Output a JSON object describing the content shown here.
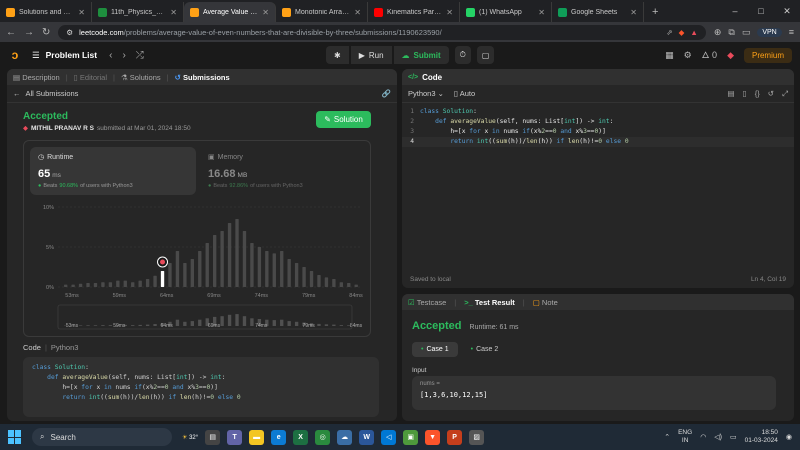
{
  "browser": {
    "tabs": [
      {
        "title": "Solutions and Explanation",
        "color": "#ffa116",
        "active": false
      },
      {
        "title": "11th_Physics_Vol_1_EM -",
        "color": "#1e8e3e",
        "active": false
      },
      {
        "title": "Average Value of Even",
        "color": "#ffa116",
        "active": true
      },
      {
        "title": "Monotonic Array - LeetC",
        "color": "#ffa116",
        "active": false
      },
      {
        "title": "Kinematics Part 3: Project",
        "color": "#ff0000",
        "active": false
      },
      {
        "title": "(1) WhatsApp",
        "color": "#25d366",
        "active": false
      },
      {
        "title": "Google Sheets",
        "color": "#0f9d58",
        "active": false
      }
    ],
    "url_host": "leetcode.com",
    "url_path": "/problems/average-value-of-even-numbers-that-are-divisible-by-three/submissions/1190623590/",
    "vpn_label": "VPN"
  },
  "lc_nav": {
    "problem_list": "Problem List",
    "run": "Run",
    "submit": "Submit",
    "streak": "0",
    "premium": "Premium"
  },
  "left": {
    "tabs": {
      "description": "Description",
      "editorial": "Editorial",
      "solutions": "Solutions",
      "submissions": "Submissions"
    },
    "all_submissions": "All Submissions",
    "status": "Accepted",
    "user": "MITHIL PRANAV R S",
    "submitted_at": "submitted at Mar 01, 2024 18:50",
    "solution_button": "Solution",
    "runtime": {
      "label": "Runtime",
      "value": "65",
      "unit": "ms",
      "beats_prefix": "Beats",
      "beats_pct": "90.68%",
      "beats_suffix": "of users with Python3"
    },
    "memory": {
      "label": "Memory",
      "value": "16.68",
      "unit": "MB",
      "beats_prefix": "Beats",
      "beats_pct": "92.86%",
      "beats_suffix": "of users with Python3"
    },
    "code_label": "Code",
    "code_lang": "Python3"
  },
  "chart_data": {
    "type": "bar",
    "y_ticks": [
      "10%",
      "5%",
      "0%"
    ],
    "ylim": [
      0,
      10
    ],
    "x_tick_labels": [
      "53ms",
      "59ms",
      "64ms",
      "69ms",
      "74ms",
      "79ms",
      "84ms"
    ],
    "values": [
      0.3,
      0.3,
      0.4,
      0.5,
      0.5,
      0.6,
      0.6,
      0.8,
      0.8,
      0.6,
      0.8,
      1.0,
      1.4,
      2.0,
      3.0,
      4.5,
      3.0,
      3.5,
      4.5,
      5.5,
      6.5,
      7.0,
      8.0,
      8.5,
      7.0,
      5.5,
      5.0,
      4.5,
      4.2,
      4.5,
      3.5,
      3.0,
      2.5,
      2.0,
      1.5,
      1.2,
      1.0,
      0.6,
      0.5,
      0.3
    ],
    "highlight_index": 13,
    "highlight_color": "#ffffff",
    "bar_color": "#4a4a4a",
    "grid": true
  },
  "code_lines": [
    [
      {
        "t": "class ",
        "c": "kw"
      },
      {
        "t": "Solution",
        "c": "cls"
      },
      {
        "t": ":",
        "c": ""
      }
    ],
    [
      {
        "t": "    ",
        "c": ""
      },
      {
        "t": "def ",
        "c": "kw"
      },
      {
        "t": "averageValue",
        "c": "fn"
      },
      {
        "t": "(self, nums: List[",
        "c": ""
      },
      {
        "t": "int",
        "c": "cls"
      },
      {
        "t": "]) -> ",
        "c": ""
      },
      {
        "t": "int",
        "c": "cls"
      },
      {
        "t": ":",
        "c": ""
      }
    ],
    [
      {
        "t": "        h=[x ",
        "c": ""
      },
      {
        "t": "for",
        "c": "kw"
      },
      {
        "t": " x ",
        "c": ""
      },
      {
        "t": "in",
        "c": "kw"
      },
      {
        "t": " nums ",
        "c": ""
      },
      {
        "t": "if",
        "c": "kw"
      },
      {
        "t": "(x%",
        "c": ""
      },
      {
        "t": "2",
        "c": "num"
      },
      {
        "t": "==",
        "c": ""
      },
      {
        "t": "0",
        "c": "num"
      },
      {
        "t": " ",
        "c": ""
      },
      {
        "t": "and",
        "c": "kw"
      },
      {
        "t": " x%",
        "c": ""
      },
      {
        "t": "3",
        "c": "num"
      },
      {
        "t": "==",
        "c": ""
      },
      {
        "t": "0",
        "c": "num"
      },
      {
        "t": ")]",
        "c": ""
      }
    ],
    [
      {
        "t": "        ",
        "c": ""
      },
      {
        "t": "return ",
        "c": "kw"
      },
      {
        "t": "int",
        "c": "cls"
      },
      {
        "t": "((",
        "c": ""
      },
      {
        "t": "sum",
        "c": "fn"
      },
      {
        "t": "(h))/",
        "c": ""
      },
      {
        "t": "len",
        "c": "fn"
      },
      {
        "t": "(h)) ",
        "c": ""
      },
      {
        "t": "if ",
        "c": "kw"
      },
      {
        "t": "len",
        "c": "fn"
      },
      {
        "t": "(h)!=",
        "c": ""
      },
      {
        "t": "0",
        "c": "num"
      },
      {
        "t": " ",
        "c": ""
      },
      {
        "t": "else ",
        "c": "kw"
      },
      {
        "t": "0",
        "c": "num"
      }
    ]
  ],
  "editor": {
    "title": "Code",
    "lang": "Python3",
    "mode": "Auto",
    "saved": "Saved to local",
    "cursor": "Ln 4, Col 19"
  },
  "tests": {
    "testcase_tab": "Testcase",
    "result_tab": "Test Result",
    "note_tab": "Note",
    "status": "Accepted",
    "runtime": "Runtime: 61 ms",
    "cases": [
      "Case 1",
      "Case 2"
    ],
    "input_label": "Input",
    "var_name": "nums =",
    "var_value": "[1,3,6,10,12,15]"
  },
  "taskbar": {
    "search": "Search",
    "weather": "32°",
    "lang_line1": "ENG",
    "lang_line2": "IN",
    "time": "18:50",
    "date": "01-03-2024"
  }
}
